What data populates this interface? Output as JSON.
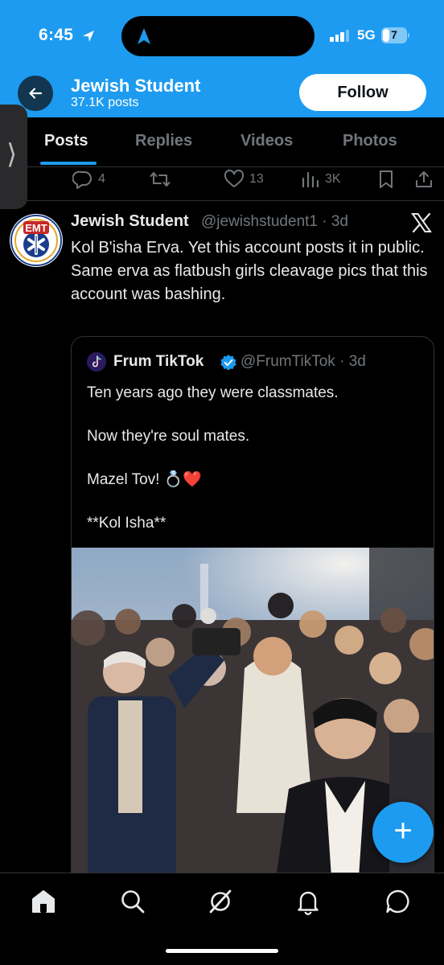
{
  "status_bar": {
    "time": "6:45",
    "network": "5G",
    "battery": "7"
  },
  "header": {
    "title": "Jewish Student",
    "post_count": "37.1K posts",
    "follow_label": "Follow"
  },
  "tabs": [
    {
      "label": "Posts",
      "active": true
    },
    {
      "label": "Replies",
      "active": false
    },
    {
      "label": "Videos",
      "active": false
    },
    {
      "label": "Photos",
      "active": false
    }
  ],
  "previous_tweet_actions": {
    "replies": "4",
    "likes": "13",
    "views": "3K"
  },
  "tweet": {
    "author": "Jewish Student",
    "handle": "@jewishstudent1 · 3d",
    "text": "Kol B'isha Erva. Yet this account posts it in public.\nSame erva as flatbush girls cleavage pics that this account was bashing.",
    "avatar_text": "EMT",
    "avatar_ring_text": "N.J. STATE DEPT. OF HEALTH"
  },
  "quote": {
    "author": "Frum TikTok",
    "handle": "@FrumTikTok · 3d",
    "text": "Ten years ago they were classmates.\n\nNow they're soul mates.\n\nMazel Tov! 💍❤️\n\n**Kol Isha**"
  },
  "icons": {
    "back": "back-arrow-icon",
    "reply": "reply-icon",
    "retweet": "retweet-icon",
    "like": "heart-icon",
    "views": "views-icon",
    "bookmark": "bookmark-icon",
    "share": "share-icon",
    "x_logo": "x-logo-icon",
    "verified": "verified-badge-icon",
    "compose": "plus-icon",
    "nav": [
      "home-icon",
      "search-icon",
      "grok-icon",
      "notifications-icon",
      "messages-icon"
    ]
  },
  "colors": {
    "accent": "#1d9bf0",
    "background": "#000000",
    "muted_text": "#71767b",
    "primary_text": "#e7e9ea"
  }
}
